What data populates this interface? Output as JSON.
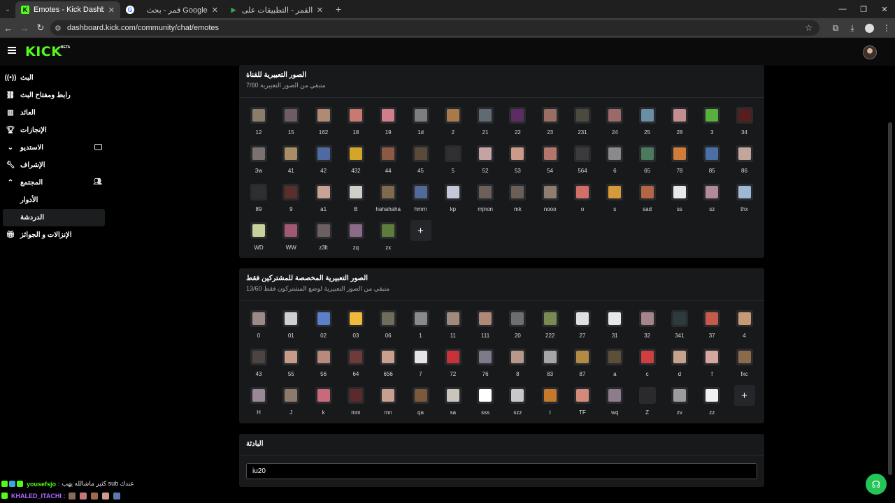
{
  "browser": {
    "tabs": [
      {
        "title": "Emotes - Kick Dashboard",
        "active": true,
        "icon": "kick-icon",
        "icon_color": "#53fc18"
      },
      {
        "title": "قمر - بحث Google",
        "active": false,
        "icon": "google-icon",
        "icon_color": "#ffffff"
      },
      {
        "title": "خلفيات القمر - التطبيقات على Google Play",
        "active": false,
        "icon": "play-store-icon",
        "icon_color": "#ffffff"
      }
    ],
    "url": "dashboard.kick.com/community/chat/emotes"
  },
  "header": {
    "logo": "KICK",
    "beta": "BETA"
  },
  "sidebar": {
    "items": [
      {
        "label": "البث",
        "icon": "broadcast-icon"
      },
      {
        "label": "رابط ومفتاح البث",
        "icon": "link-icon"
      },
      {
        "label": "العائد",
        "icon": "chart-icon"
      },
      {
        "label": "الإنجازات",
        "icon": "trophy-icon"
      },
      {
        "label": "الاستديو",
        "icon": "chevron-down-icon"
      },
      {
        "label": "الإشراف",
        "icon": "wrench-icon"
      },
      {
        "label": "المجتمع",
        "icon": "chevron-up-icon"
      }
    ],
    "community_sub": [
      {
        "label": "الأدوار"
      },
      {
        "label": "الدردشة"
      }
    ],
    "last_item": {
      "label": "الإنزالات و الجوائز",
      "icon": "gift-icon"
    }
  },
  "channel_emotes": {
    "title": "الصور التعبيرية للقناة",
    "subtitle": "متبقي من الصور التعبيرية 7/60",
    "emotes": [
      "12",
      "15",
      "162",
      "18",
      "19",
      "1d",
      "2",
      "21",
      "22",
      "23",
      "231",
      "24",
      "25",
      "28",
      "3",
      "34",
      "3w",
      "41",
      "42",
      "432",
      "44",
      "45",
      "5",
      "52",
      "53",
      "54",
      "564",
      "6",
      "65",
      "78",
      "85",
      "86",
      "89",
      "9",
      "a1",
      "B",
      "hahahaha",
      "hmm",
      "kp",
      "mjnon",
      "mk",
      "nooo",
      "o",
      "s",
      "sad",
      "ss",
      "sz",
      "thx",
      "WD",
      "WW",
      "z3lt",
      "zq",
      "zx"
    ],
    "colors": [
      "#8a7d6c",
      "#6f5c63",
      "#b08a72",
      "#c9796f",
      "#d07d8c",
      "#7d7d82",
      "#a9794a",
      "#5f6a72",
      "#5c2d63",
      "#9b6e63",
      "#4b4a3d",
      "#9a6a6a",
      "#6b8ea3",
      "#c38e8f",
      "#58b03c",
      "#5a1d1d",
      "#7b7270",
      "#a88d66",
      "#4f6aa0",
      "#d5a52a",
      "#8c5a43",
      "#5b4a3a",
      "#303030",
      "#c5a3a3",
      "#c99b88",
      "#b4766a",
      "#3b3b3b",
      "#8a8a8a",
      "#4c7a5d",
      "#d17c38",
      "#4a6ea6",
      "#c2a69a",
      "#2f2f2f",
      "#5a2e2a",
      "#caa196",
      "#d0cfc5",
      "#7e6a4c",
      "#516a9a",
      "#c5c8d8",
      "#6e5f5a",
      "#6a5e58",
      "#8e7e70",
      "#d36f69",
      "#d69a3a",
      "#b36548",
      "#e9e9e9",
      "#b38a98",
      "#9db8d4",
      "#c8d39c",
      "#a05873",
      "#6c5f5f",
      "#8b6a88",
      "#5d7e3a"
    ]
  },
  "subscriber_emotes": {
    "title": "الصور التعبيرية المخصصة للمشتركين فقط",
    "subtitle": "متبقي من الصور التعبيرية لوضع المشتركون فقط 13/60",
    "emotes": [
      "0",
      "01",
      "02",
      "03",
      "06",
      "1",
      "11",
      "111",
      "20",
      "222",
      "27",
      "31",
      "32",
      "341",
      "37",
      "4",
      "43",
      "55",
      "56",
      "64",
      "656",
      "7",
      "72",
      "76",
      "8",
      "83",
      "87",
      "a",
      "c",
      "d",
      "f",
      "fxc",
      "H",
      "J",
      "k",
      "mm",
      "mn",
      "qa",
      "sa",
      "sss",
      "szz",
      "t",
      "TF",
      "wq",
      "Z",
      "zv",
      "zz"
    ],
    "colors": [
      "#9b8a86",
      "#d0d0d0",
      "#5b7fc9",
      "#f0b93a",
      "#6f6e5c",
      "#8a8a8a",
      "#a08a7c",
      "#b08878",
      "#6e6e6e",
      "#7a8a52",
      "#e0e0e0",
      "#e8e8e8",
      "#a6848b",
      "#2e3b3c",
      "#c45a4b",
      "#c79a76",
      "#4c4440",
      "#c69b8a",
      "#b88a7c",
      "#6e3a3a",
      "#c9a08e",
      "#e5e5e5",
      "#c8333a",
      "#7f7a8a",
      "#b89888",
      "#a6a6a6",
      "#b28a46",
      "#5c4f38",
      "#cf3f3f",
      "#c7a28c",
      "#d6a6a0",
      "#8e6a4c",
      "#9a8898",
      "#8c7a6a",
      "#c76b7a",
      "#5c2a2a",
      "#c8a090",
      "#7a5a3a",
      "#c9c4bc",
      "#ffffff",
      "#c8c8c8",
      "#c47a2a",
      "#d48a7a",
      "#8c7c8c",
      "#2a2a2a",
      "#9c9c9c",
      "#f0f0f0"
    ]
  },
  "prefix": {
    "title": "البادئة",
    "value": "iu20"
  },
  "chat": [
    {
      "user": "yousefsjo",
      "user_color": "#53fc18",
      "message": "كثير ماشالله يهب sub عندك",
      "badges": [
        "#53fc18",
        "#3aa8d8",
        "#53fc18"
      ]
    },
    {
      "user": "KHALED_ITACHI",
      "user_color": "#b06bff",
      "message": "",
      "badges": [
        "#53fc18"
      ],
      "emote_colors": [
        "#8a6a5a",
        "#c4787a",
        "#a06a4a",
        "#caa08a",
        "#5a7ab0"
      ]
    }
  ]
}
